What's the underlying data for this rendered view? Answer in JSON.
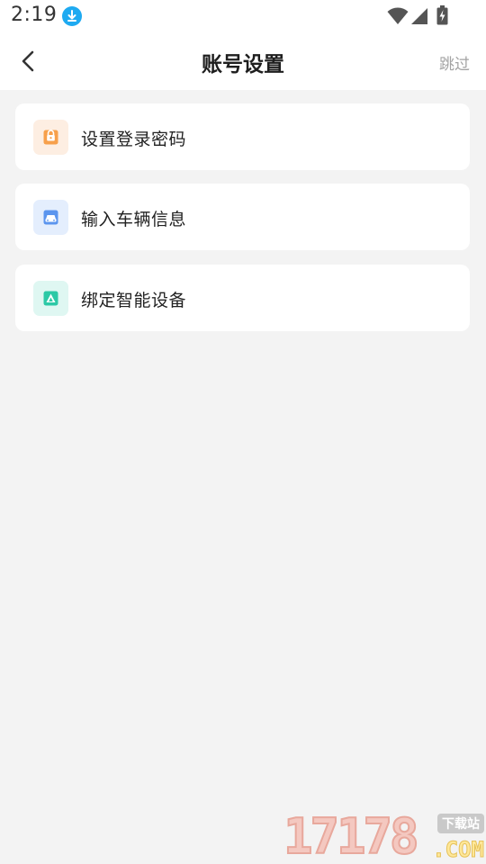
{
  "status_bar": {
    "time": "2:19",
    "icons": [
      "download-icon",
      "wifi-icon",
      "signal-icon",
      "battery-charging-icon"
    ],
    "download_color": "#1eaaf1"
  },
  "header": {
    "title": "账号设置",
    "skip_label": "跳过",
    "back_icon": "chevron-left-icon"
  },
  "menu": {
    "items": [
      {
        "label": "设置登录密码",
        "icon": "lock-icon",
        "icon_bg": "#fdeee2",
        "icon_color": "#f7a04b"
      },
      {
        "label": "输入车辆信息",
        "icon": "car-icon",
        "icon_bg": "#e4eefd",
        "icon_color": "#5b95ee"
      },
      {
        "label": "绑定智能设备",
        "icon": "device-icon",
        "icon_bg": "#dff7f2",
        "icon_color": "#2cc9a6"
      }
    ]
  },
  "watermark": {
    "digits": "17178",
    "tag": "下载站",
    "domain": ".COM"
  },
  "colors": {
    "background": "#f3f3f3",
    "card": "#ffffff",
    "skip_text": "#a3a3a3"
  }
}
